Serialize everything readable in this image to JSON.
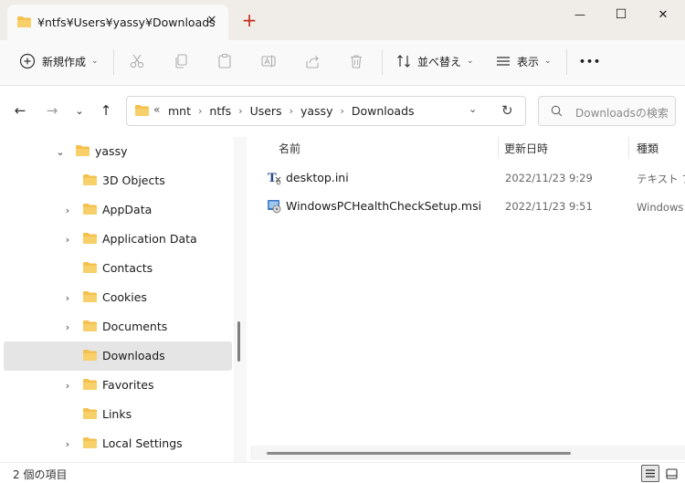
{
  "window": {
    "tab_title": "¥ntfs¥Users¥yassy¥Downloads",
    "new_tab": "+",
    "minimize_label": "—",
    "maximize_label": "☐",
    "close_label": "✕"
  },
  "toolbar": {
    "new_label": "新規作成",
    "sort_label": "並べ替え",
    "view_label": "表示",
    "more_label": "•••"
  },
  "address": {
    "crumb_overflow": "«",
    "crumbs": [
      "mnt",
      "ntfs",
      "Users",
      "yassy",
      "Downloads"
    ],
    "search_placeholder": "Downloadsの検索"
  },
  "nav": {
    "items": [
      {
        "label": "yassy",
        "expanded": true
      },
      {
        "label": "3D Objects"
      },
      {
        "label": "AppData"
      },
      {
        "label": "Application Data"
      },
      {
        "label": "Contacts"
      },
      {
        "label": "Cookies"
      },
      {
        "label": "Documents"
      },
      {
        "label": "Downloads",
        "selected": true
      },
      {
        "label": "Favorites"
      },
      {
        "label": "Links"
      },
      {
        "label": "Local Settings"
      }
    ]
  },
  "files": {
    "columns": {
      "name": "名前",
      "modified": "更新日時",
      "type": "種類"
    },
    "rows": [
      {
        "name": "desktop.ini",
        "modified": "2022/11/23 9:29",
        "type": "テキスト ファイル"
      },
      {
        "name": "WindowsPCHealthCheckSetup.msi",
        "modified": "2022/11/23 9:51",
        "type": "Windows インストーラー パッケージ"
      }
    ]
  },
  "status": {
    "item_count": "2 個の項目"
  },
  "colors": {
    "accent": "#e8a70a",
    "folder": "#f4c04e",
    "selected": "#e5e5e5"
  }
}
